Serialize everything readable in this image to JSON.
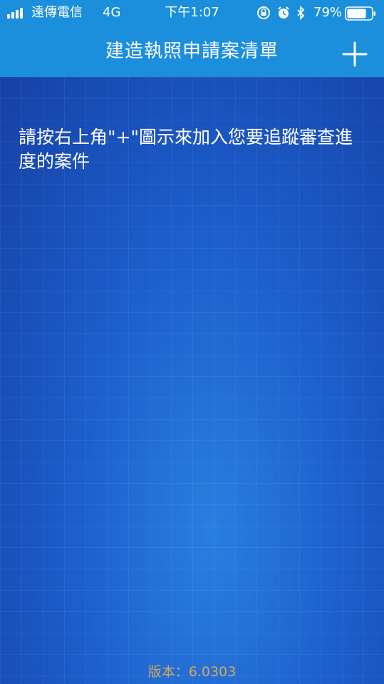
{
  "status_bar": {
    "carrier": "遠傳電信",
    "network": "4G",
    "time": "下午1:07",
    "battery_percent": "79%",
    "battery_level": 0.79,
    "icons": [
      "signal-icon",
      "orientation-lock-icon",
      "alarm-icon",
      "bluetooth-icon",
      "battery-icon"
    ]
  },
  "navbar": {
    "title": "建造執照申請案清單",
    "add_icon": "plus-icon"
  },
  "main": {
    "instruction": "請按右上角\"+\"圖示來加入您要追蹤審查進度的案件",
    "version": "版本：6.0303"
  },
  "colors": {
    "navbar": "#1b8fdc",
    "background": "#1a56bf",
    "version_text": "#d6a85c"
  }
}
